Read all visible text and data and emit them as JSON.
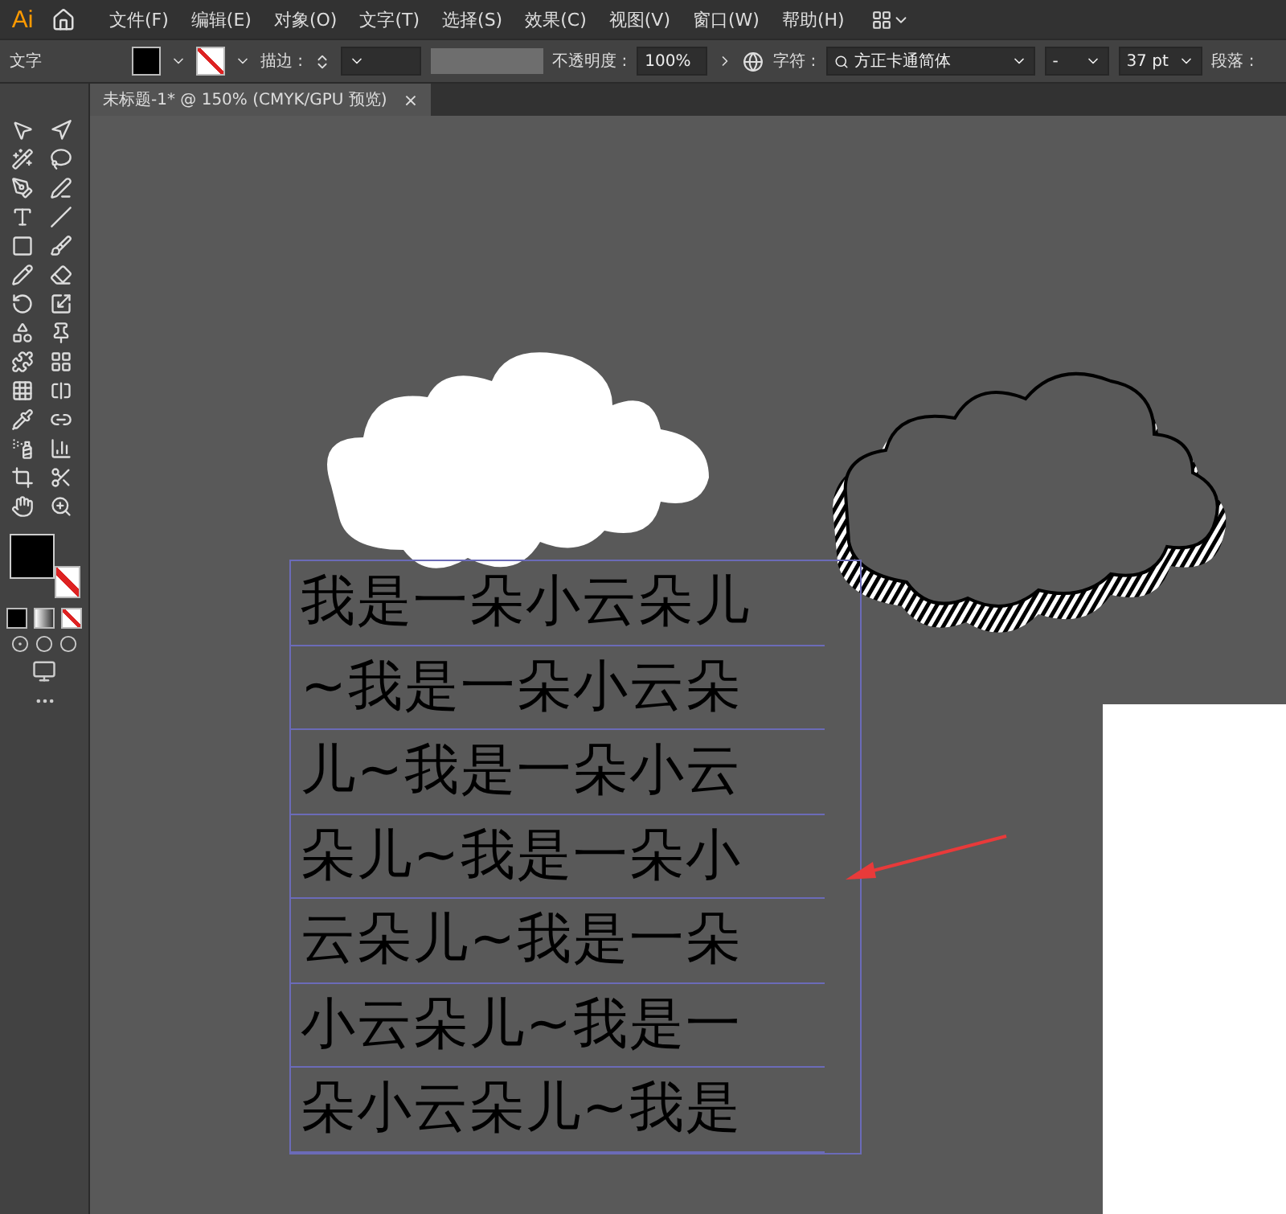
{
  "app": {
    "logo": "Ai"
  },
  "menu": [
    "文件(F)",
    "编辑(E)",
    "对象(O)",
    "文字(T)",
    "选择(S)",
    "效果(C)",
    "视图(V)",
    "窗口(W)",
    "帮助(H)"
  ],
  "control_bar": {
    "selection_label": "文字",
    "stroke_label": "描边 :",
    "opacity_label": "不透明度 :",
    "opacity": "100%",
    "character_label": "字符 :",
    "font": "方正卡通简体",
    "font_style": "-",
    "font_size": "37 pt",
    "paragraph_label": "段落 :"
  },
  "document_tab": {
    "title": "未标题-1* @ 150% (CMYK/GPU 预览)",
    "close": "×"
  },
  "canvas": {
    "text_lines": [
      "我是一朵小云朵儿",
      "~我是一朵小云朵",
      "儿~我是一朵小云",
      "朵儿~我是一朵小",
      "云朵儿~我是一朵",
      "小云朵儿~我是一",
      "朵小云朵儿~我是"
    ]
  }
}
